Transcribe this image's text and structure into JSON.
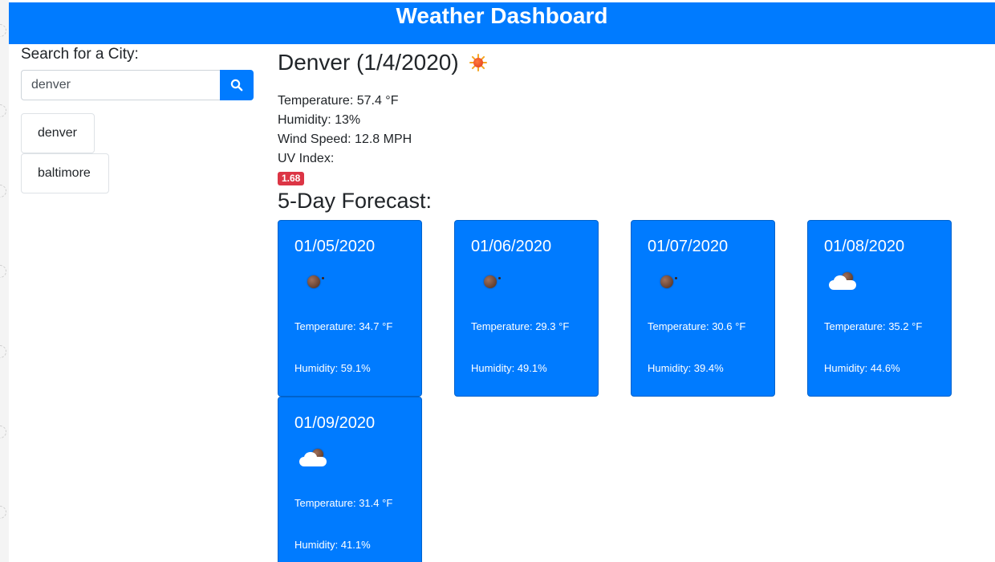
{
  "header": {
    "title": "Weather Dashboard"
  },
  "sidebar": {
    "label": "Search for a City:",
    "search_value": "denver",
    "search_icon": "search-icon",
    "cities": [
      "denver",
      "baltimore"
    ]
  },
  "current": {
    "title": "Denver (1/4/2020)",
    "icon": "sun-icon",
    "temperature": "Temperature: 57.4 °F",
    "humidity": "Humidity: 13%",
    "wind": "Wind Speed: 12.8 MPH",
    "uv_label": "UV Index:",
    "uv_value": "1.68"
  },
  "forecast": {
    "title": "5-Day Forecast:",
    "days": [
      {
        "date": "01/05/2020",
        "icon": "moon-icon",
        "temp": "Temperature: 34.7 °F",
        "humidity": "Humidity: 59.1%"
      },
      {
        "date": "01/06/2020",
        "icon": "moon-icon",
        "temp": "Temperature: 29.3 °F",
        "humidity": "Humidity: 49.1%"
      },
      {
        "date": "01/07/2020",
        "icon": "moon-icon",
        "temp": "Temperature: 30.6 °F",
        "humidity": "Humidity: 39.4%"
      },
      {
        "date": "01/08/2020",
        "icon": "cloud-moon-icon",
        "temp": "Temperature: 35.2 °F",
        "humidity": "Humidity: 44.6%"
      },
      {
        "date": "01/09/2020",
        "icon": "cloud-moon-icon",
        "temp": "Temperature: 31.4 °F",
        "humidity": "Humidity: 41.1%"
      }
    ]
  },
  "colors": {
    "primary": "#007bff",
    "danger": "#dc3545"
  }
}
